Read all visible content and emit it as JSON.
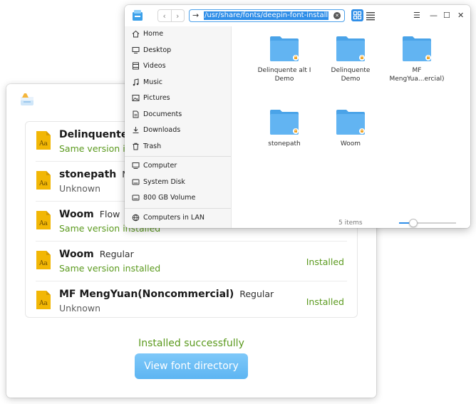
{
  "installer": {
    "fonts": [
      {
        "name": "Delinquente l",
        "style": "",
        "status": "Same version installed",
        "status_color": "green",
        "action": ""
      },
      {
        "name": "stonepath",
        "style": "Me",
        "status": "Unknown",
        "status_color": "gray",
        "action": ""
      },
      {
        "name": "Woom",
        "style": "Flow",
        "status": "Same version installed",
        "status_color": "green",
        "action": ""
      },
      {
        "name": "Woom",
        "style": "Regular",
        "status": "Same version installed",
        "status_color": "green",
        "action": "Installed"
      },
      {
        "name": "MF MengYuan(Noncommercial)",
        "style": "Regular",
        "status": "Unknown",
        "status_color": "gray",
        "action": "Installed"
      }
    ],
    "success_message": "Installed successfully",
    "view_button": "View font directory",
    "file_icon_text": "Aa"
  },
  "file_manager": {
    "address": "/usr/share/fonts/deepin-font-install",
    "nav_back": "‹",
    "nav_forward": "›",
    "address_arrow": "→",
    "sidebar": [
      {
        "label": "Home",
        "icon": "home-icon"
      },
      {
        "label": "Desktop",
        "icon": "desktop-icon"
      },
      {
        "label": "Videos",
        "icon": "videos-icon"
      },
      {
        "label": "Music",
        "icon": "music-icon"
      },
      {
        "label": "Pictures",
        "icon": "pictures-icon"
      },
      {
        "label": "Documents",
        "icon": "documents-icon"
      },
      {
        "label": "Downloads",
        "icon": "downloads-icon"
      },
      {
        "label": "Trash",
        "icon": "trash-icon"
      },
      {
        "label": "Computer",
        "icon": "computer-icon"
      },
      {
        "label": "System Disk",
        "icon": "disk-icon"
      },
      {
        "label": "800 GB Volume",
        "icon": "disk-icon"
      },
      {
        "label": "Computers in LAN",
        "icon": "network-icon"
      }
    ],
    "folders": [
      {
        "line1": "Delinquente alt I",
        "line2": "Demo"
      },
      {
        "line1": "Delinquente",
        "line2": "Demo"
      },
      {
        "line1": "MF",
        "line2": "MengYua...ercial)"
      },
      {
        "line1": "stonepath",
        "line2": ""
      },
      {
        "line1": "Woom",
        "line2": ""
      }
    ],
    "item_count": "5 items",
    "zoom_level": 0.25,
    "colors": {
      "accent": "#2f8ee8",
      "folder": "#62b4f2",
      "folder_tab": "#4aa3e8",
      "installed_green": "#5b9a1e"
    }
  }
}
